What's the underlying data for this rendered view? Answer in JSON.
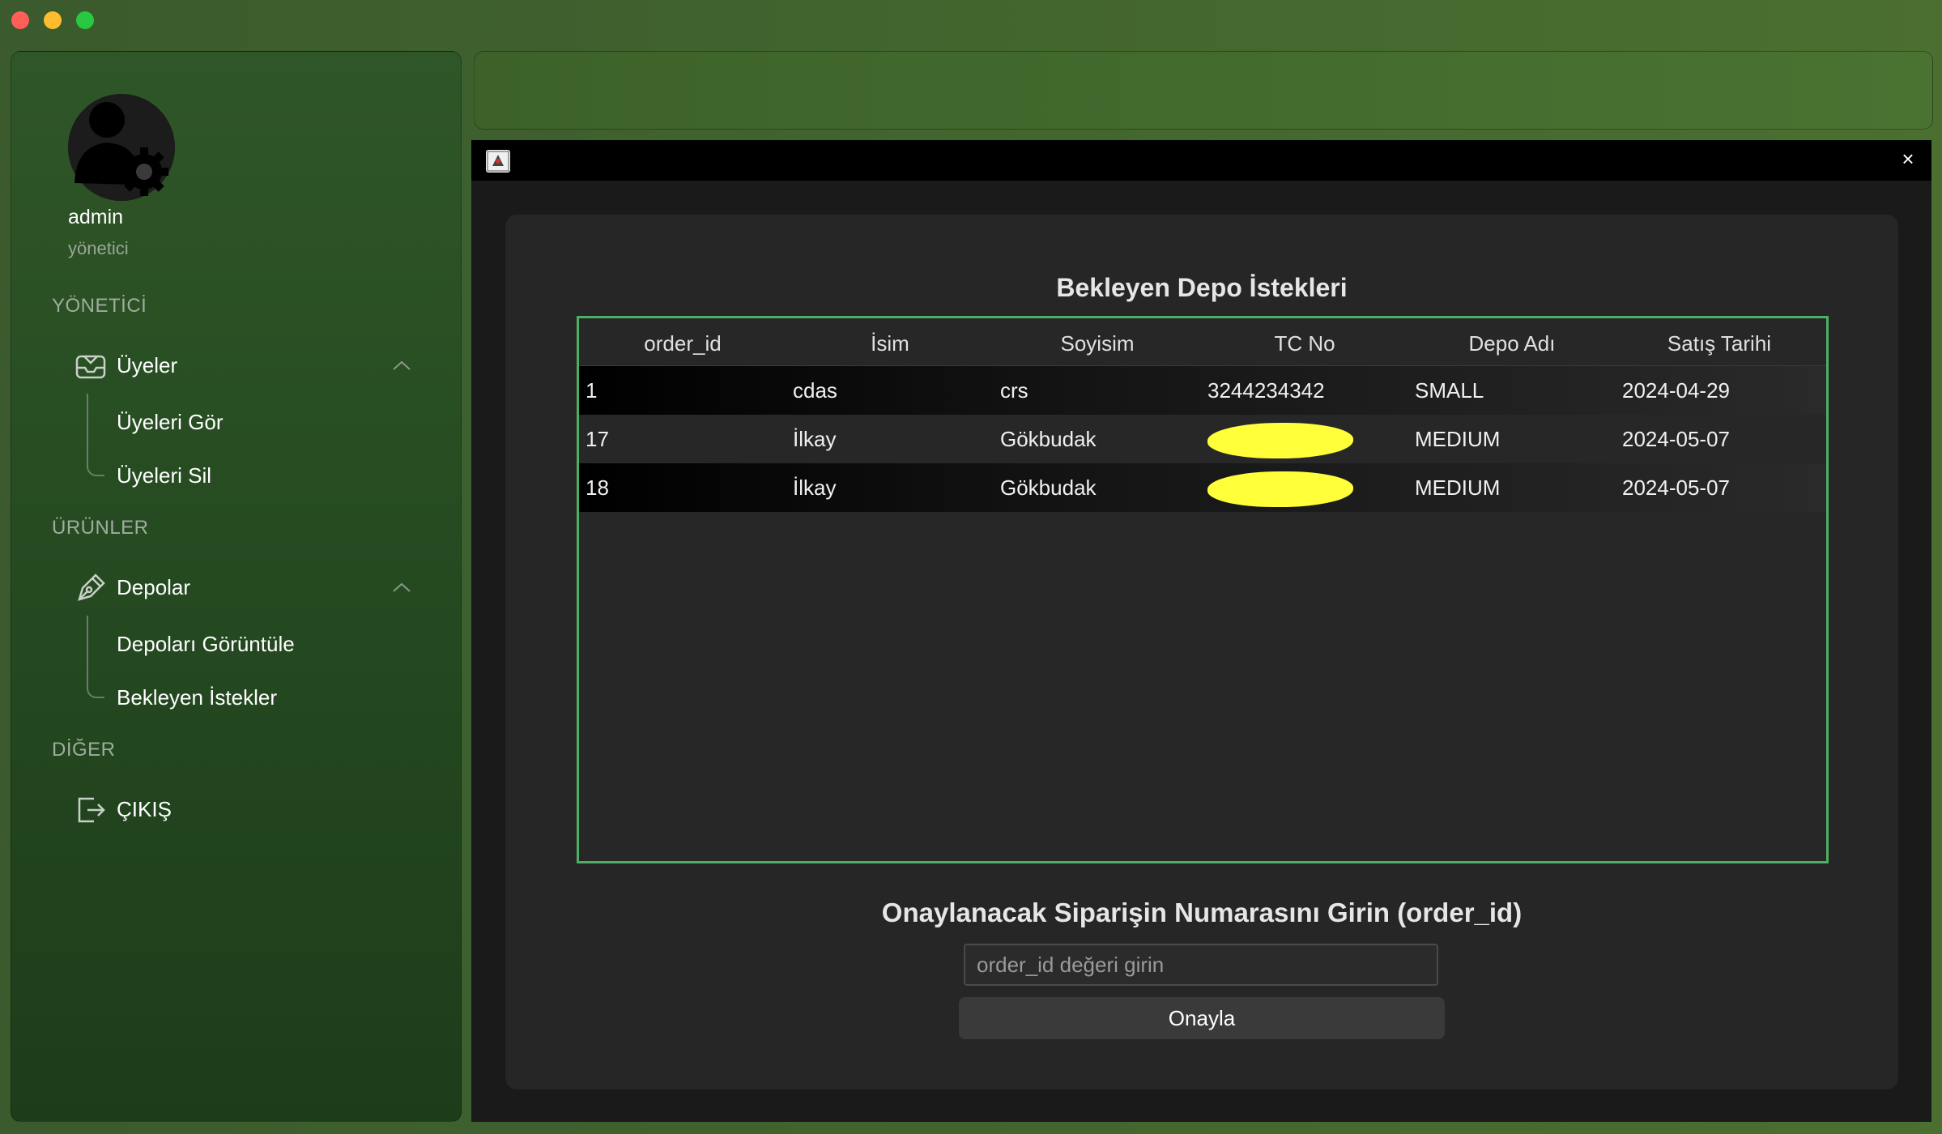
{
  "window": {
    "traffic_colors": {
      "close": "#ff5f57",
      "minimize": "#febc2e",
      "zoom": "#28c840"
    }
  },
  "user": {
    "name": "admin",
    "role": "yönetici"
  },
  "sidebar": {
    "sections": [
      {
        "label": "YÖNETİCİ"
      },
      {
        "label": "ÜRÜNLER"
      },
      {
        "label": "DİĞER"
      }
    ],
    "members": {
      "label": "Üyeler",
      "icon": "inbox-icon",
      "items": [
        "Üyeleri Gör",
        "Üyeleri Sil"
      ]
    },
    "depots": {
      "label": "Depolar",
      "icon": "pen-icon",
      "items": [
        "Depoları Görüntüle",
        "Bekleyen İstekler"
      ]
    },
    "logout": {
      "label": "ÇIKIŞ",
      "icon": "logout-icon"
    }
  },
  "dialog": {
    "title": "Bekleyen Depo İstekleri",
    "close_label": "×",
    "table": {
      "headers": [
        "order_id",
        "İsim",
        "Soyisim",
        "TC No",
        "Depo Adı",
        "Satış Tarihi"
      ],
      "rows": [
        [
          "1",
          "cdas",
          "crs",
          "3244234342",
          "SMALL",
          "2024-04-29"
        ],
        [
          "17",
          "İlkay",
          "Gökbudak",
          "",
          "MEDIUM",
          "2024-05-07"
        ],
        [
          "18",
          "İlkay",
          "Gökbudak",
          "",
          "MEDIUM",
          "2024-05-07"
        ]
      ]
    },
    "prompt": "Onaylanacak Siparişin Numarasını Girin (order_id)",
    "input": {
      "placeholder": "order_id değeri girin",
      "value": ""
    },
    "confirm_label": "Onayla"
  },
  "colors": {
    "accent_border": "#4caf63",
    "redaction": "#ffff3a"
  }
}
